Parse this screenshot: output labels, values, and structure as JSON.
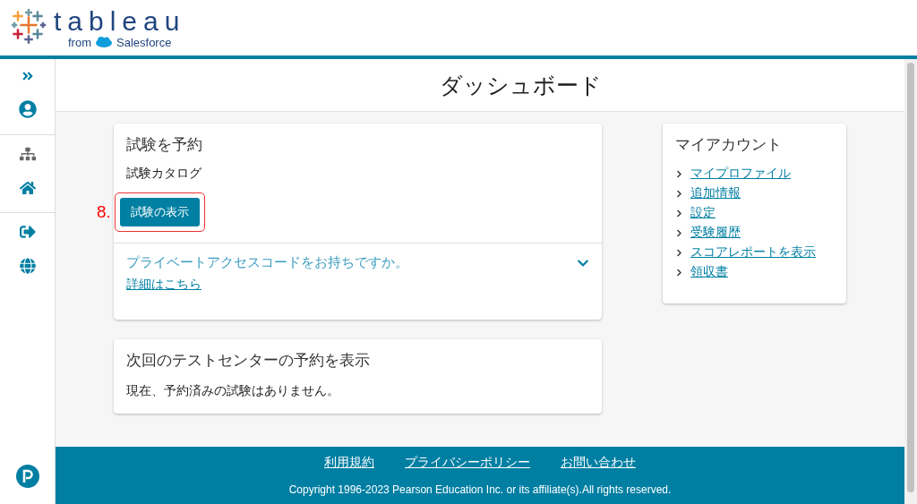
{
  "header": {
    "brand": "tableau",
    "brand_from": "from",
    "brand_partner": "Salesforce"
  },
  "page_title": "ダッシュボード",
  "booking_card": {
    "title": "試験を予約",
    "subtitle": "試験カタログ",
    "step_marker": "8.",
    "button": "試験の表示",
    "access_question": "プライベートアクセスコードをお持ちですか。",
    "access_link": "詳細はこちら",
    "expanded": false
  },
  "appointments_card": {
    "title": "次回のテストセンターの予約を表示",
    "message": "現在、予約済みの試験はありません。"
  },
  "account_card": {
    "title": "マイアカウント",
    "links": [
      "マイプロファイル",
      "追加情報",
      "設定",
      "受験履歴",
      "スコアレポートを表示",
      "領収書"
    ]
  },
  "footer": {
    "links": [
      "利用規約",
      "プライバシーポリシー",
      "お問い合わせ"
    ],
    "copyright": "Copyright 1996-2023 Pearson Education Inc. or its affiliate(s).All rights reserved."
  }
}
